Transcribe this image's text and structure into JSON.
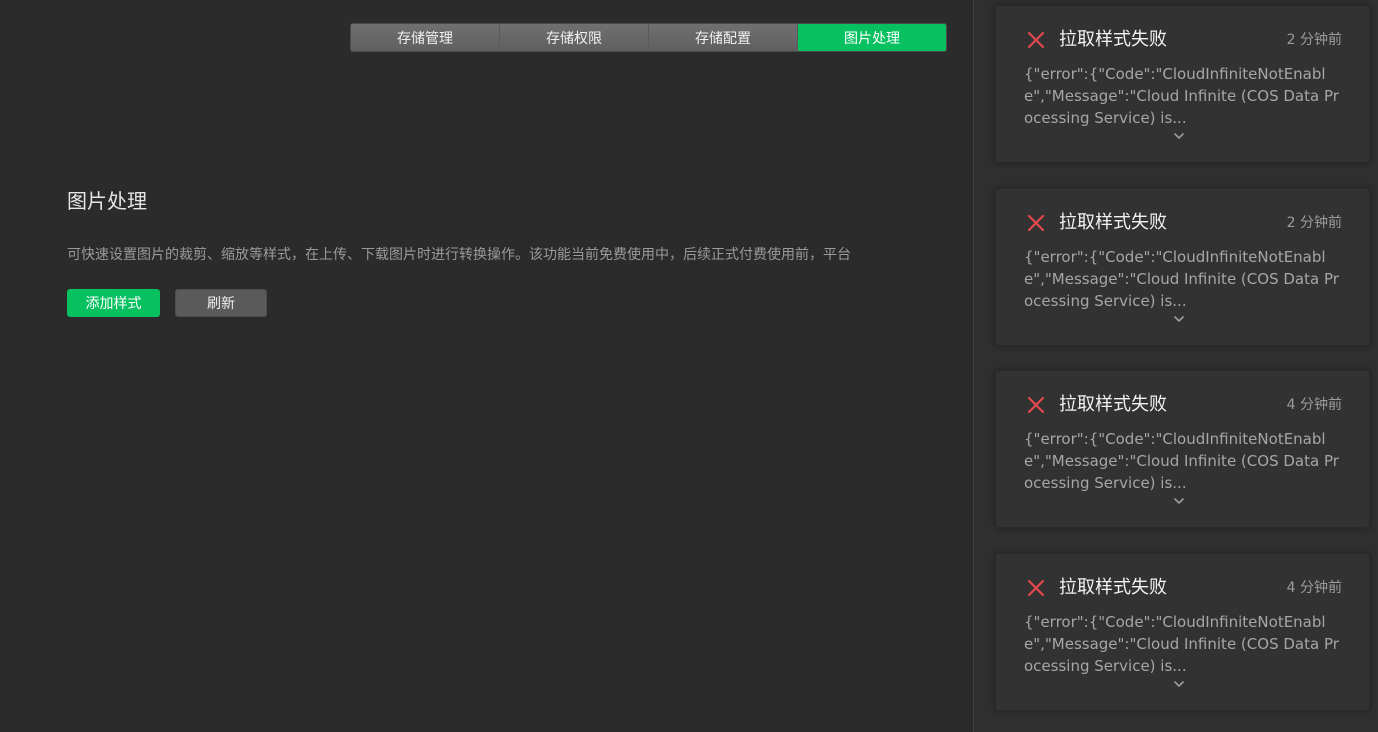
{
  "tabs": [
    {
      "label": "存储管理"
    },
    {
      "label": "存储权限"
    },
    {
      "label": "存储配置"
    },
    {
      "label": "图片处理"
    }
  ],
  "active_tab_index": 3,
  "main": {
    "title": "图片处理",
    "description": "可快速设置图片的裁剪、缩放等样式，在上传、下载图片时进行转换操作。该功能当前免费使用中，后续正式付费使用前，平台",
    "add_button": "添加样式",
    "refresh_button": "刷新"
  },
  "notifications": [
    {
      "title": "拉取样式失败",
      "time": "2 分钟前",
      "body": "{\"error\":{\"Code\":\"CloudInfiniteNotEnable\",\"Message\":\"Cloud Infinite (COS Data Processing Service) is..."
    },
    {
      "title": "拉取样式失败",
      "time": "2 分钟前",
      "body": "{\"error\":{\"Code\":\"CloudInfiniteNotEnable\",\"Message\":\"Cloud Infinite (COS Data Processing Service) is..."
    },
    {
      "title": "拉取样式失败",
      "time": "4 分钟前",
      "body": "{\"error\":{\"Code\":\"CloudInfiniteNotEnable\",\"Message\":\"Cloud Infinite (COS Data Processing Service) is..."
    },
    {
      "title": "拉取样式失败",
      "time": "4 分钟前",
      "body": "{\"error\":{\"Code\":\"CloudInfiniteNotEnable\",\"Message\":\"Cloud Infinite (COS Data Processing Service) is..."
    }
  ],
  "colors": {
    "accent": "#07c160",
    "error": "#e5484d",
    "background": "#2b2b2b"
  },
  "icons": {
    "notification": "close-x-icon",
    "expand": "chevron-down-icon"
  }
}
